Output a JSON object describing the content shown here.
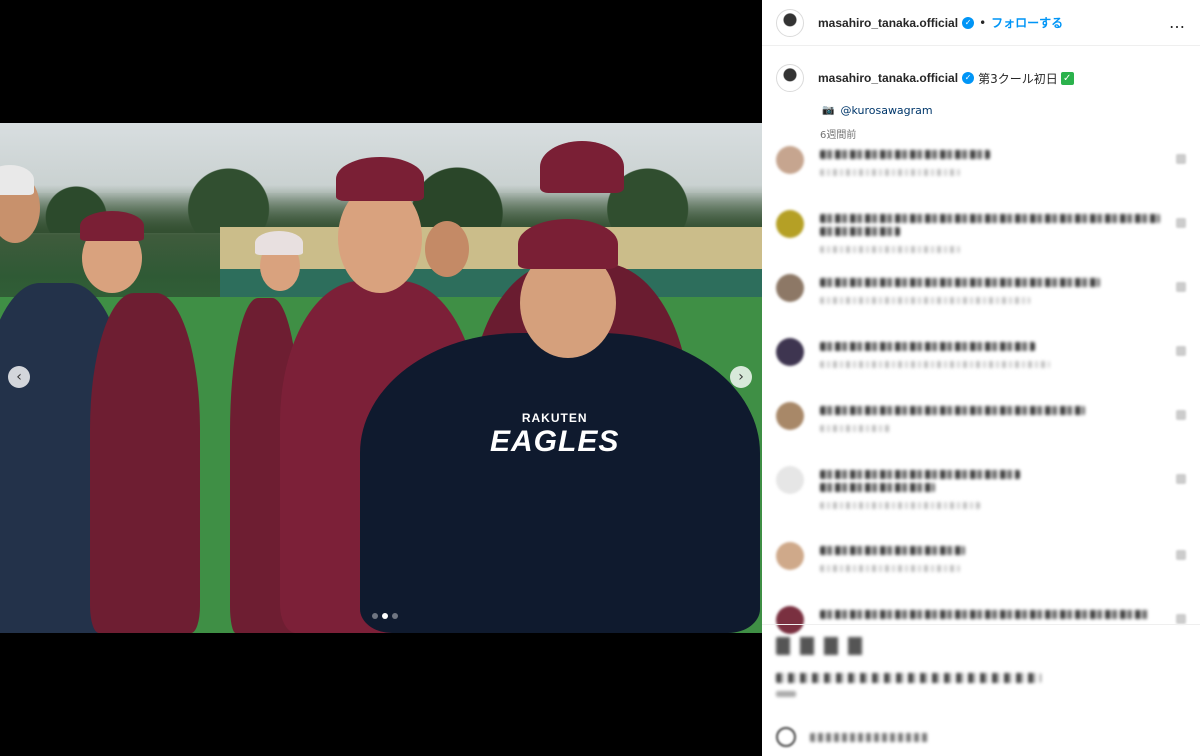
{
  "post": {
    "username": "masahiro_tanaka.official",
    "follow_label": "フォローする",
    "separator": "•",
    "more_label": "…",
    "caption_text": "第3クール初日",
    "caption_emoji": "✓",
    "photo_credit": "@kurosawagram",
    "time_ago": "6週間前",
    "carousel": {
      "slides": 3,
      "active": 2
    }
  },
  "photo": {
    "jersey_text_1": "RAKUTEN",
    "jersey_text_2": "EAGLES"
  },
  "colors": {
    "accent": "#0095f6",
    "jersey_maroon": "#7a1f35",
    "jersey_navy": "#0f1a2e",
    "grass": "#3f8f45"
  },
  "icons": {
    "prev": "chevron-left-icon",
    "next": "chevron-right-icon",
    "verified": "verified-badge-icon",
    "camera": "camera-icon"
  }
}
